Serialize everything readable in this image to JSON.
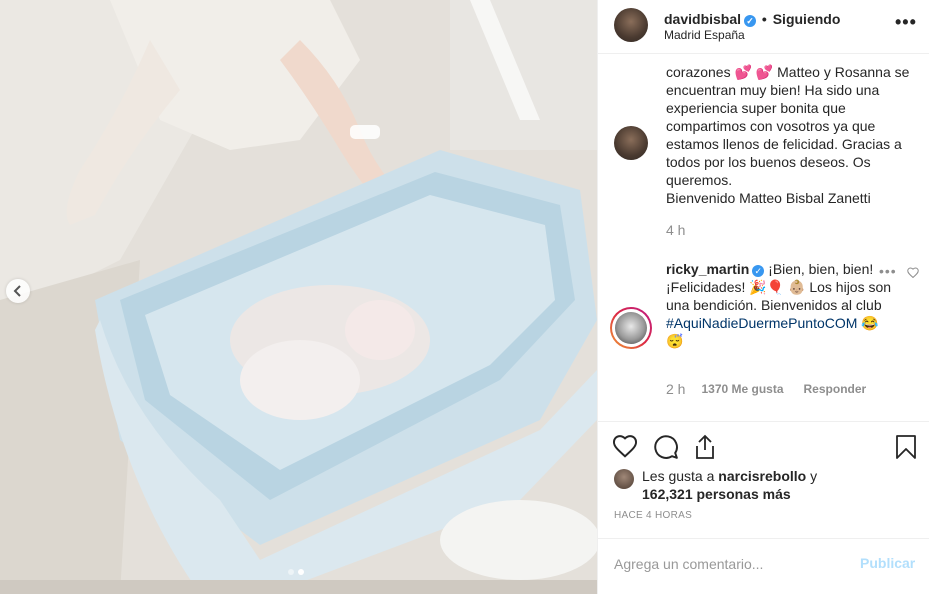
{
  "header": {
    "username": "davidbisbal",
    "separator": "•",
    "follow_status": "Siguiendo",
    "location": "Madrid España",
    "more": "•••"
  },
  "caption": {
    "text": "corazones 💕 💕 Matteo y Rosanna se encuentran muy bien! Ha sido una experiencia super bonita que compartimos con vosotros ya que estamos llenos de felicidad. Gracias a todos por los buenos deseos. Os queremos.",
    "text2": "Bienvenido Matteo Bisbal Zanetti",
    "time": "4 h"
  },
  "reply": {
    "username": "ricky_martin",
    "text": "¡Bien, bien, bien!¡Felicidades! 🎉🎈 👶🏼 Los hijos son una bendición. Bienvenidos al club",
    "hashtag": "#AquiNadieDuermePuntoCOM",
    "emoji_end": "😂 😴",
    "more": "•••",
    "time": "2 h",
    "likes": "1370 Me gusta",
    "reply_label": "Responder"
  },
  "likes": {
    "prefix": "Les gusta a",
    "user": "narcisrebollo",
    "connector": "y",
    "count": "162,321 personas más"
  },
  "post_time": "HACE 4 HORAS",
  "comment_box": {
    "placeholder": "Agrega un comentario...",
    "publish": "Publicar"
  },
  "colors": {
    "verified": "#3897f0",
    "publish_disabled": "#b2dffc",
    "hashtag": "#003569",
    "meta_gray": "#8e8e8e"
  },
  "carousel": {
    "count": 2,
    "active": 2
  }
}
